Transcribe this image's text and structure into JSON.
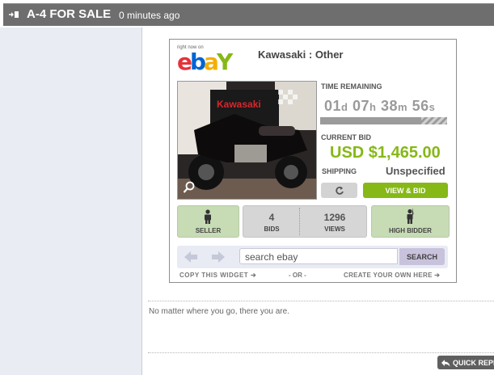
{
  "post": {
    "title": "A-4 FOR SALE",
    "time": "0 minutes ago",
    "body": "No matter where you go, there you are."
  },
  "widget": {
    "tagline": "right now on",
    "logo": {
      "e": "e",
      "b": "b",
      "a": "a",
      "y": "Y"
    },
    "item_title": "Kawasaki : Other",
    "time_remaining_label": "TIME REMAINING",
    "countdown": {
      "days": "01",
      "days_unit": "d",
      "hours": "07",
      "hours_unit": "h",
      "minutes": "38",
      "minutes_unit": "m",
      "seconds": "56",
      "seconds_unit": "s"
    },
    "current_bid_label": "CURRENT BID",
    "price": "USD $1,465.00",
    "shipping_label": "SHIPPING",
    "shipping_value": "Unspecified",
    "view_bid_label": "VIEW & BID",
    "seller_label": "SELLER",
    "bids_count": "4",
    "bids_label": "BIDS",
    "views_count": "1296",
    "views_label": "VIEWS",
    "high_bidder_label": "HIGH BIDDER",
    "search_placeholder": "search ebay",
    "search_button": "SEARCH",
    "copy_widget": "COPY THIS WIDGET",
    "or_text": "- OR -",
    "create_own": "CREATE YOUR OWN HERE",
    "photo_sign_text": "Kawasaki"
  },
  "quick_reply": "QUICK REPLY",
  "colors": {
    "header_bg": "#6e6e6e",
    "ebay_green": "#86b817",
    "left_panel": "#e9edf3"
  }
}
